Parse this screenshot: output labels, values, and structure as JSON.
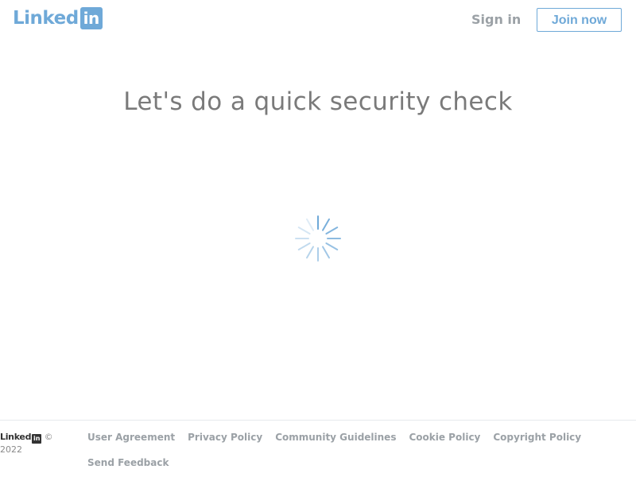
{
  "header": {
    "logo": {
      "word": "Linked",
      "box": "in"
    },
    "sign_in_label": "Sign in",
    "join_now_label": "Join now"
  },
  "main": {
    "title": "Let's do a quick security check",
    "spinner_icon": "loading-spinner-icon"
  },
  "footer": {
    "logo": {
      "word": "Linked",
      "box": "in"
    },
    "copyright": "© 2022",
    "links": [
      "User Agreement",
      "Privacy Policy",
      "Community Guidelines",
      "Cookie Policy",
      "Copyright Policy",
      "Send Feedback"
    ]
  },
  "colors": {
    "brand": "#6fa9d8",
    "muted_text": "#9ba1a6",
    "title_text": "#7a7a7a"
  }
}
